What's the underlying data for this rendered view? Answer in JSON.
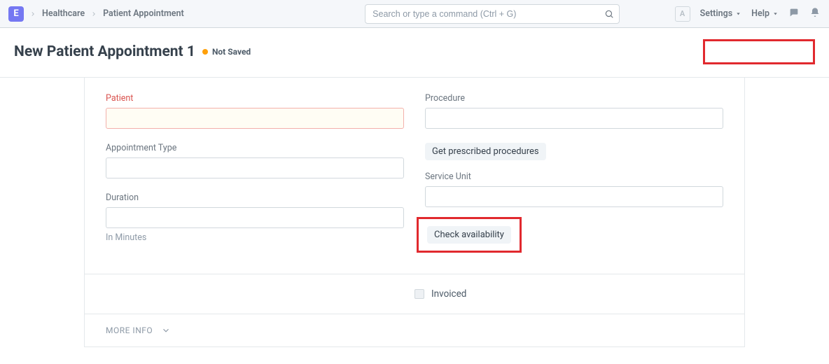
{
  "navbar": {
    "logo_letter": "E",
    "breadcrumbs": [
      "Healthcare",
      "Patient Appointment"
    ],
    "search_placeholder": "Search or type a command (Ctrl + G)",
    "avatar_initial": "A",
    "settings_label": "Settings",
    "help_label": "Help"
  },
  "header": {
    "title": "New Patient Appointment 1",
    "status_label": "Not Saved"
  },
  "form": {
    "left": {
      "patient_label": "Patient",
      "patient_value": "",
      "appt_type_label": "Appointment Type",
      "appt_type_value": "",
      "duration_label": "Duration",
      "duration_value": "",
      "duration_help": "In Minutes"
    },
    "right": {
      "procedure_label": "Procedure",
      "procedure_value": "",
      "get_procedures_btn": "Get prescribed procedures",
      "service_unit_label": "Service Unit",
      "service_unit_value": "",
      "check_availability_btn": "Check availability"
    }
  },
  "section2": {
    "invoiced_label": "Invoiced",
    "invoiced_checked": false
  },
  "section3": {
    "more_info_label": "More Info"
  }
}
